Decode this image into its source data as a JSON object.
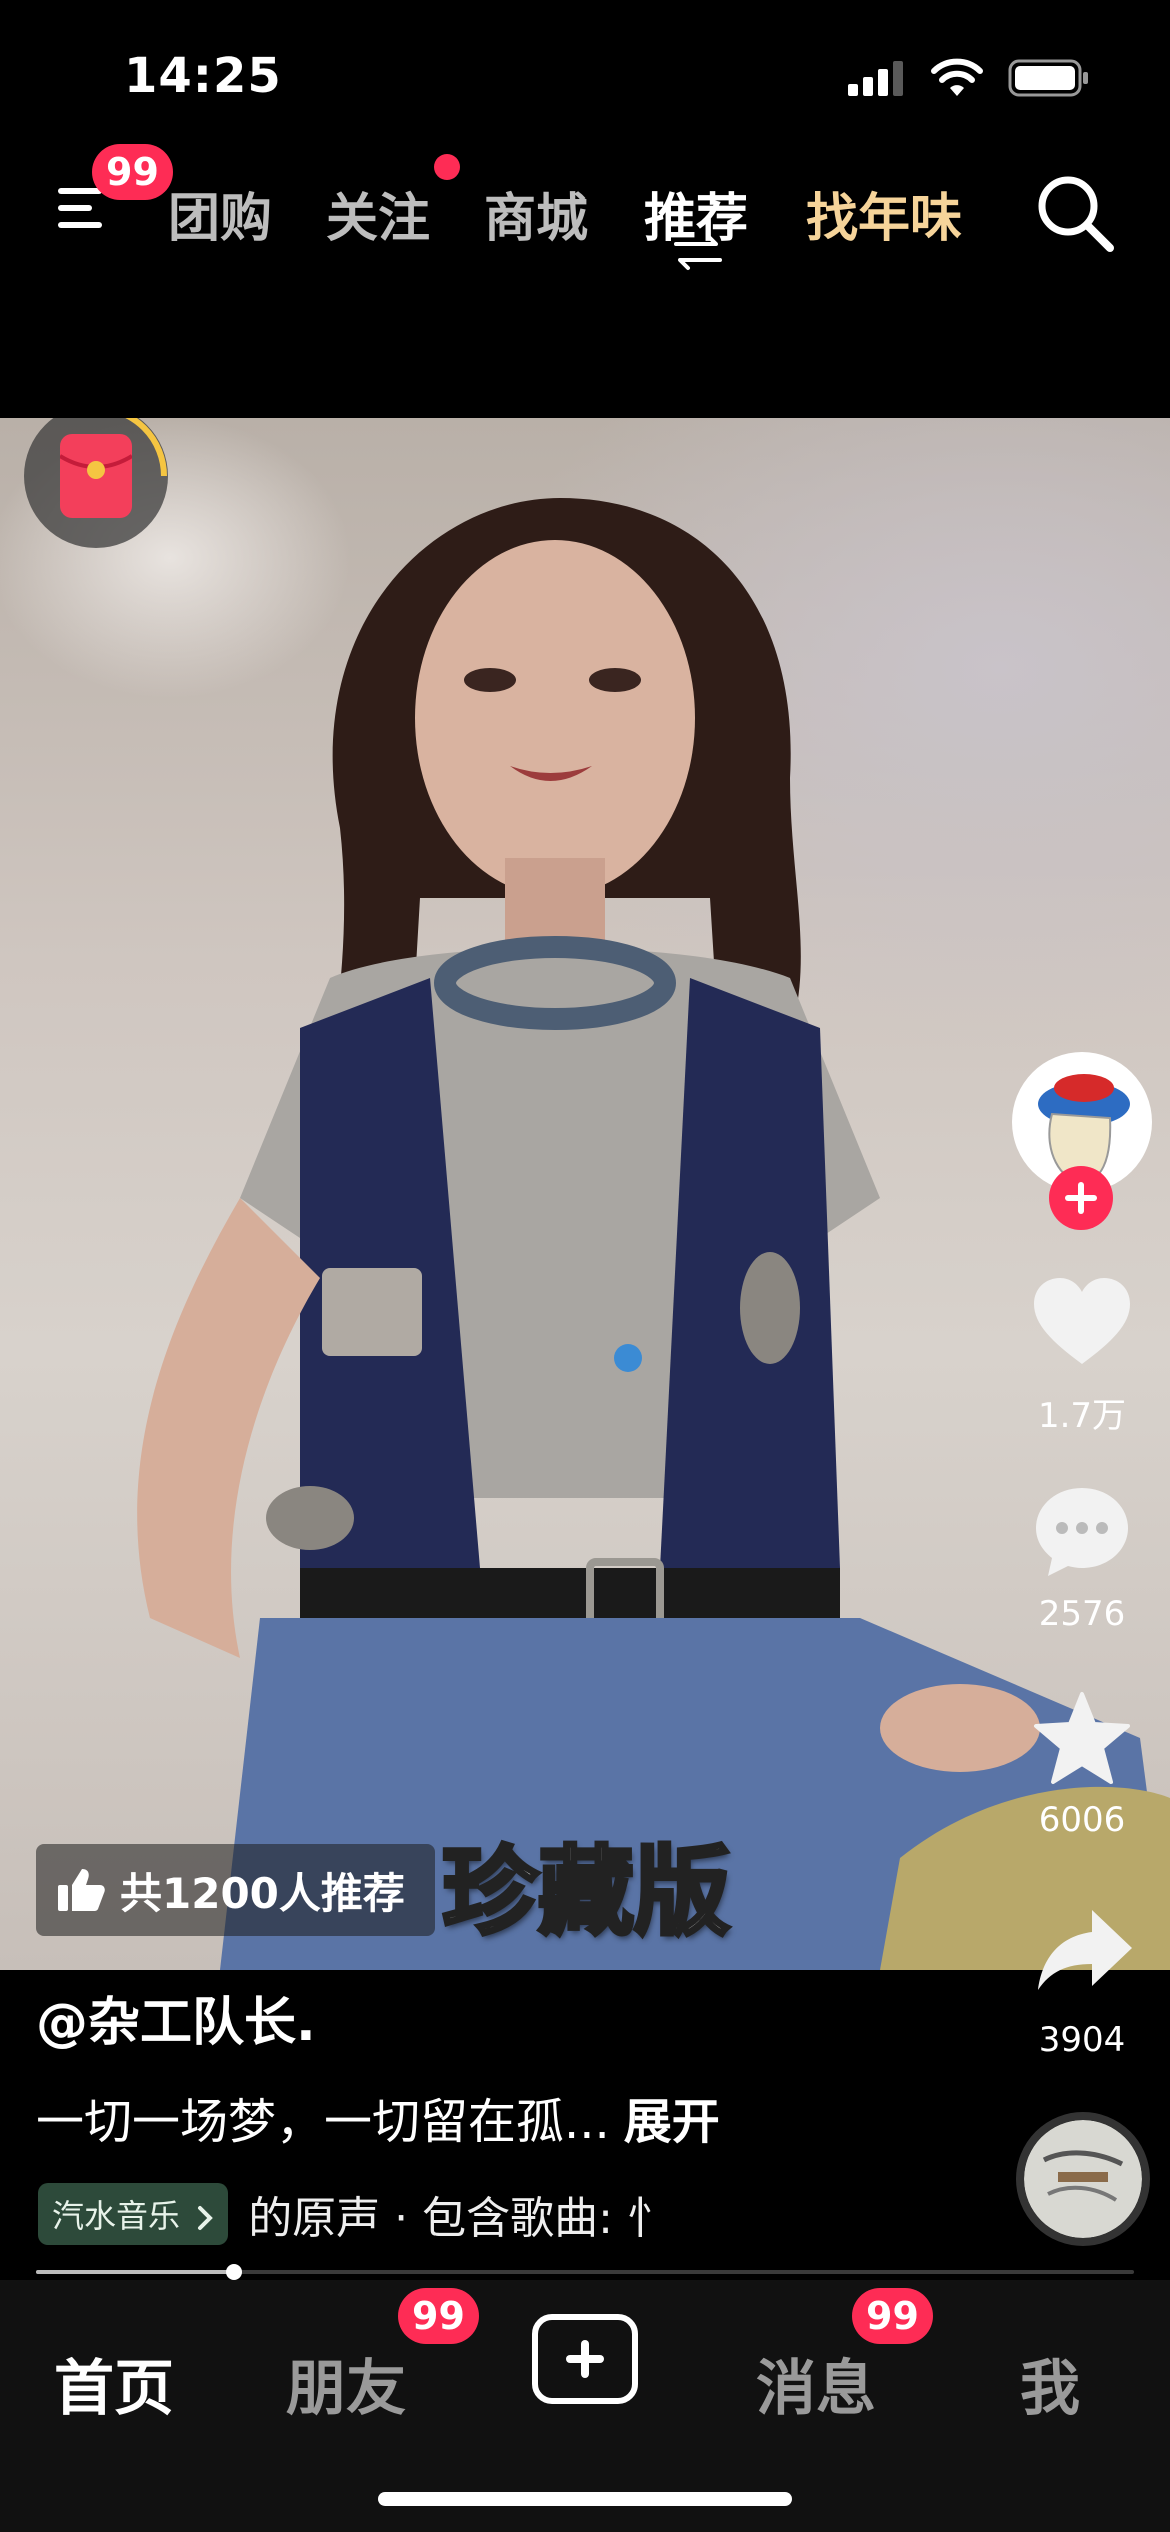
{
  "status_bar": {
    "time": "14:25"
  },
  "top_nav": {
    "menu_badge": "99",
    "tabs": [
      {
        "label": "团购"
      },
      {
        "label": "关注"
      },
      {
        "label": "商城"
      },
      {
        "label": "推荐"
      },
      {
        "label": "找年味"
      }
    ]
  },
  "video": {
    "overlay_title": "珍藏版",
    "recommend_text": "共1200人推荐"
  },
  "rail": {
    "likes": "1.7万",
    "comments": "2576",
    "favorites": "6006",
    "shares": "3904"
  },
  "caption": {
    "author": "@杂工队长.",
    "description": "一切一场梦，一切留在孤...",
    "expand_label": "展开",
    "music_app": "汽水音乐",
    "music_text": "的原声 · 包含歌曲: 忄"
  },
  "playback": {
    "progress": 0.18
  },
  "tabbar": {
    "home": "首页",
    "friends": "朋友",
    "friends_badge": "99",
    "messages": "消息",
    "messages_badge": "99",
    "me": "我"
  },
  "colors": {
    "accent": "#fe2c55",
    "special_tab": "#f6d49a"
  }
}
